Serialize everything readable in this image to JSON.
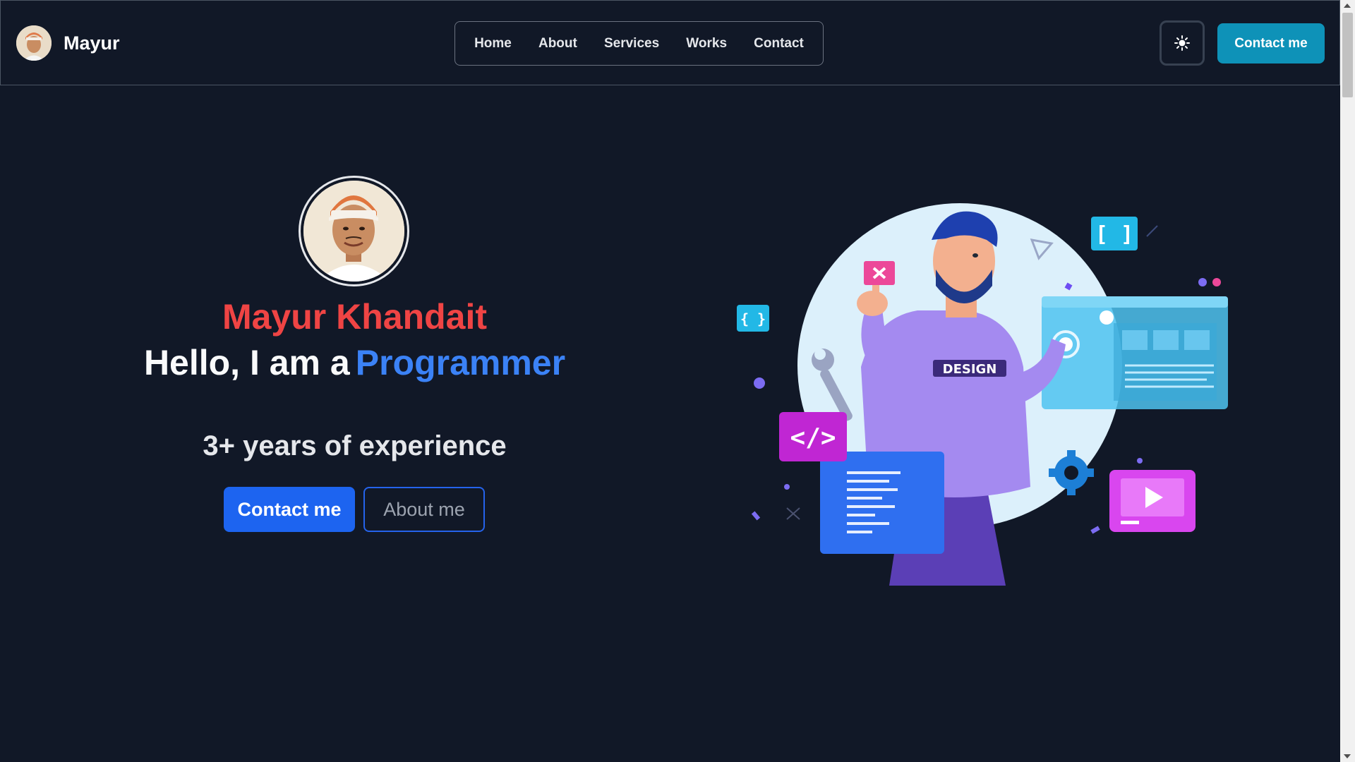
{
  "navbar": {
    "brand_name": "Mayur",
    "links": [
      "Home",
      "About",
      "Services",
      "Works",
      "Contact"
    ],
    "cta_label": "Contact me"
  },
  "hero": {
    "name": "Mayur Khandait",
    "greeting": "Hello, I am a",
    "role": "Programmer",
    "experience": "3+ years of experience",
    "contact_button": "Contact me",
    "about_button": "About me"
  },
  "illustration": {
    "shirt_text": "DESIGN"
  },
  "colors": {
    "background": "#111827",
    "name_red": "#ef4444",
    "role_blue": "#3b82f6",
    "primary_button": "#1d64f0",
    "nav_cta": "#0e92b8"
  },
  "icons": [
    "sun-icon",
    "avatar",
    "code-icon",
    "play-icon",
    "gear-icon",
    "wrench-icon"
  ]
}
